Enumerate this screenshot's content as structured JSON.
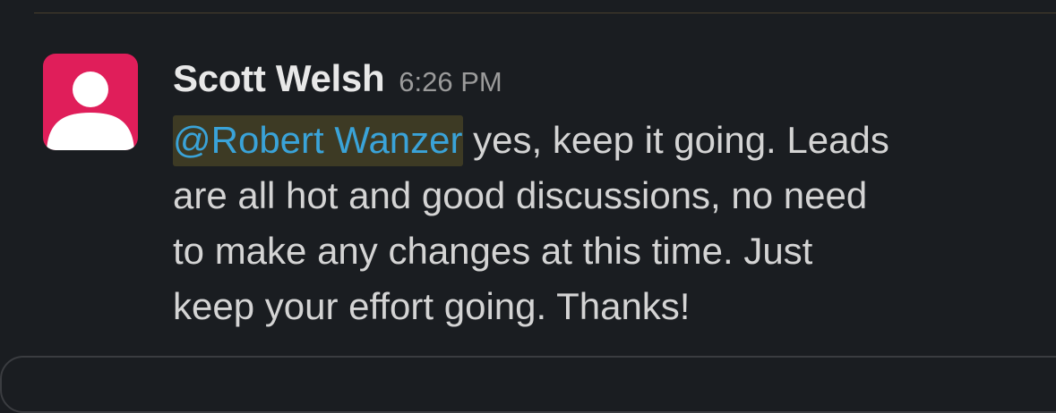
{
  "message": {
    "author": "Scott Welsh",
    "timestamp": "6:26 PM",
    "mention": "@Robert Wanzer",
    "lines": [
      " yes, keep it going. Leads",
      "are all hot and good discussions, no need",
      "to make any changes at this time. Just",
      "keep your effort going. Thanks!"
    ]
  },
  "colors": {
    "background": "#1a1d21",
    "avatar": "#e01e5a",
    "mention_text": "#3aa3d8",
    "mention_highlight": "#3d3a24",
    "author": "#e8e8e8",
    "timestamp": "#9b9b9b",
    "body": "#d4d4d4"
  },
  "icons": {
    "avatar": "default-user-icon"
  }
}
